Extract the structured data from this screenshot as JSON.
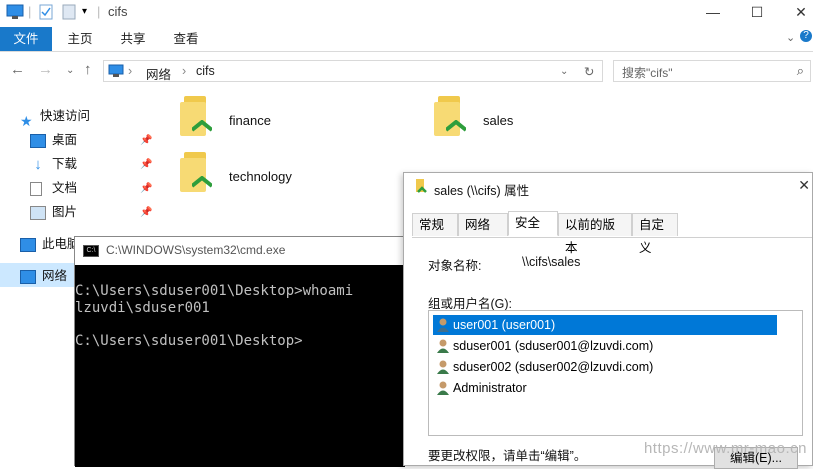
{
  "explorer": {
    "title": "cifs",
    "ribbon_tabs": [
      "文件",
      "主页",
      "共享",
      "查看"
    ],
    "breadcrumb": [
      "网络",
      "cifs"
    ],
    "search_placeholder": "搜索\"cifs\"",
    "nav_items": [
      {
        "label": "快速访问",
        "icon": "star-icon"
      },
      {
        "label": "桌面",
        "icon": "desktop-icon",
        "pinned": true
      },
      {
        "label": "下载",
        "icon": "download-icon",
        "pinned": true
      },
      {
        "label": "文档",
        "icon": "document-icon",
        "pinned": true
      },
      {
        "label": "图片",
        "icon": "picture-icon",
        "pinned": true
      },
      {
        "label": "此电脑",
        "icon": "computer-icon"
      },
      {
        "label": "网络",
        "icon": "network-icon"
      }
    ],
    "folders": [
      "finance",
      "sales",
      "technology"
    ]
  },
  "cmd": {
    "title": "C:\\WINDOWS\\system32\\cmd.exe",
    "lines": [
      "C:\\Users\\sduser001\\Desktop>whoami",
      "lzuvdi\\sduser001",
      "",
      "C:\\Users\\sduser001\\Desktop>"
    ]
  },
  "dialog": {
    "title": "sales (\\\\cifs) 属性",
    "tabs": [
      "常规",
      "网络",
      "安全",
      "以前的版本",
      "自定义"
    ],
    "active_tab": "安全",
    "object_name_label": "对象名称:",
    "object_name_value": "\\\\cifs\\sales",
    "group_label": "组或用户名(G):",
    "users": [
      "user001 (user001)",
      "sduser001 (sduser001@lzuvdi.com)",
      "sduser002 (sduser002@lzuvdi.com)",
      "Administrator"
    ],
    "selected_user_index": 0,
    "change_hint": "要更改权限，请单击“编辑”。",
    "edit_button": "编辑(E)..."
  },
  "watermark": "https://www.mr-mao.cn",
  "colors": {
    "accent": "#1979ca",
    "selection": "#0078d7",
    "console_bg": "#000000"
  }
}
